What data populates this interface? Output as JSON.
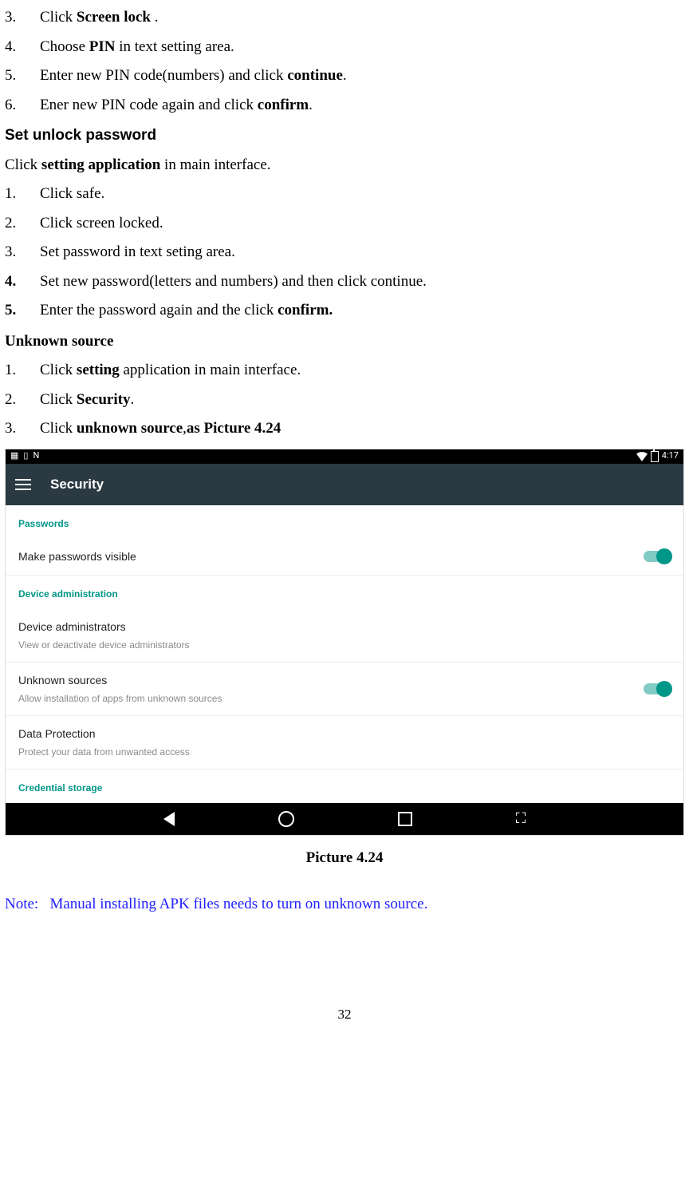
{
  "listA": {
    "items": [
      {
        "num": "3.",
        "pre": "Click ",
        "bold": "Screen lock",
        "post": " ."
      },
      {
        "num": "4.",
        "pre": "Choose ",
        "bold": "PIN",
        "post": " in text setting area."
      },
      {
        "num": "5.",
        "pre": "Enter new PIN code(numbers) and click ",
        "bold": "continue",
        "post": "."
      },
      {
        "num": "6.",
        "pre": "Ener new PIN code again and click ",
        "bold": "confirm",
        "post": "."
      }
    ]
  },
  "headingA": "Set unlock password",
  "paraA_pre": "Click ",
  "paraA_bold": "setting application",
  "paraA_post": " in main interface.",
  "listB": {
    "items": [
      {
        "num": "1.",
        "text": "Click safe.",
        "numBold": false
      },
      {
        "num": "2.",
        "text": "Click screen locked.",
        "numBold": false
      },
      {
        "num": "3.",
        "text": "Set password in text seting area.",
        "numBold": false
      },
      {
        "num": "4.",
        "text": "Set new password(letters and numbers) and then click continue.",
        "numBold": true
      },
      {
        "num": "5.",
        "pre": "Enter the password again and the click ",
        "bold": "confirm.",
        "post": "",
        "numBold": true
      }
    ]
  },
  "headingB": "Unknown source",
  "listC": {
    "items": [
      {
        "num": "1.",
        "pre": "Click ",
        "bold": "setting",
        "post": " application in main interface."
      },
      {
        "num": "2.",
        "pre": "Click ",
        "bold": "Security",
        "post": "."
      },
      {
        "num": "3.",
        "pre": "Click ",
        "bold": "unknown source",
        "post": ",",
        "bold2": "as Picture 4.24"
      }
    ]
  },
  "screenshot": {
    "status_time": "4:17",
    "app_title": "Security",
    "sections": {
      "s1": "Passwords",
      "s2": "Device administration",
      "s3": "Credential storage"
    },
    "items": {
      "vis": "Make passwords visible",
      "da_t": "Device administrators",
      "da_s": "View or deactivate device administrators",
      "us_t": "Unknown sources",
      "us_s": "Allow installation of apps from unknown sources",
      "dp_t": "Data Protection",
      "dp_s": "Protect your data from unwanted access"
    }
  },
  "caption": "Picture 4.24",
  "note_label": "Note:",
  "note_text": "Manual installing APK files needs to turn on unknown source.",
  "page_number": "32"
}
